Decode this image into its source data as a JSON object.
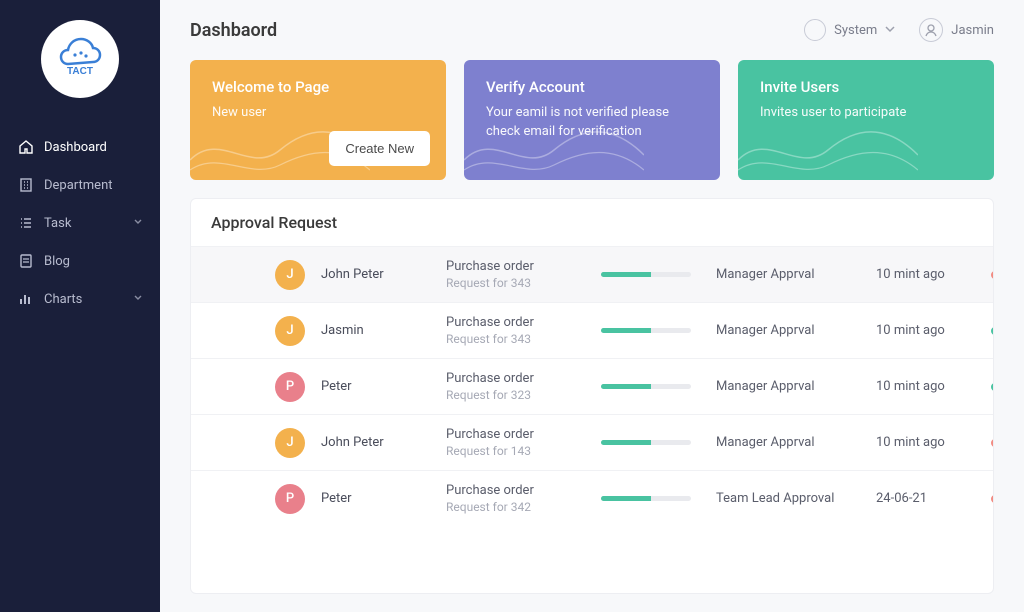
{
  "app": {
    "name": "TACT"
  },
  "header": {
    "title": "Dashbaord",
    "system_label": "System",
    "user_name": "Jasmin"
  },
  "sidebar": {
    "items": [
      {
        "label": "Dashboard",
        "icon": "home-icon",
        "active": true
      },
      {
        "label": "Department",
        "icon": "building-icon"
      },
      {
        "label": "Task",
        "icon": "list-icon",
        "expandable": true
      },
      {
        "label": "Blog",
        "icon": "doc-icon"
      },
      {
        "label": "Charts",
        "icon": "bars-icon",
        "expandable": true
      }
    ]
  },
  "cards": [
    {
      "title": "Welcome to Page",
      "body": "New user",
      "button": "Create New",
      "color": "orange"
    },
    {
      "title": "Verify Account",
      "body": "Your eamil is not verified please check email for verification",
      "color": "purple"
    },
    {
      "title": "Invite Users",
      "body": "Invites user to participate",
      "color": "teal"
    }
  ],
  "approval": {
    "title": "Approval Request",
    "rows": [
      {
        "initial": "J",
        "avcolor": "orange",
        "name": "John Peter",
        "req": "Purchase order",
        "sub": "Request for 343",
        "progress": 55,
        "stage": "Manager Apprval",
        "time": "10 mint ago",
        "dot": "red",
        "highlight": true
      },
      {
        "initial": "J",
        "avcolor": "orange",
        "name": "Jasmin",
        "req": "Purchase order",
        "sub": "Request for 343",
        "progress": 55,
        "stage": "Manager Apprval",
        "time": "10 mint ago",
        "dot": "green"
      },
      {
        "initial": "P",
        "avcolor": "pink",
        "name": "Peter",
        "req": "Purchase order",
        "sub": "Request for 323",
        "progress": 55,
        "stage": "Manager Apprval",
        "time": "10 mint ago",
        "dot": "green"
      },
      {
        "initial": "J",
        "avcolor": "orange",
        "name": "John Peter",
        "req": "Purchase order",
        "sub": "Request for 143",
        "progress": 55,
        "stage": "Manager Apprval",
        "time": "10 mint ago",
        "dot": "red"
      },
      {
        "initial": "P",
        "avcolor": "pink",
        "name": "Peter",
        "req": "Purchase order",
        "sub": "Request for 342",
        "progress": 55,
        "stage": "Team Lead Approval",
        "time": "24-06-21",
        "dot": "red"
      }
    ]
  }
}
